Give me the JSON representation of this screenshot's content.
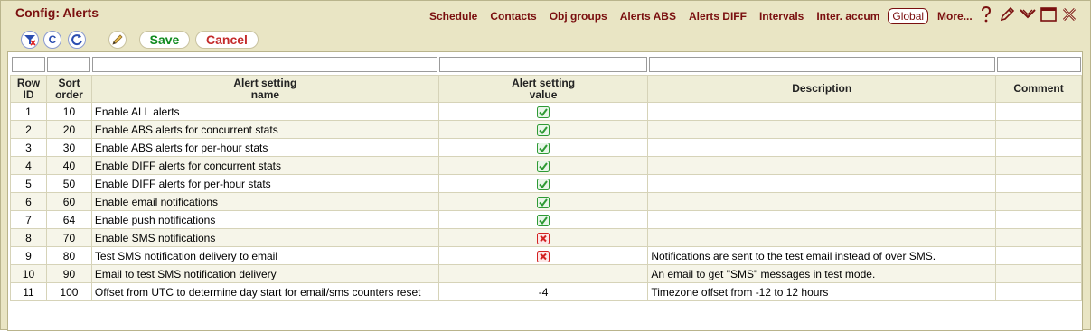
{
  "window": {
    "title": "Config: Alerts"
  },
  "nav": {
    "links": [
      {
        "label": "Schedule"
      },
      {
        "label": "Contacts"
      },
      {
        "label": "Obj groups"
      },
      {
        "label": "Alerts ABS"
      },
      {
        "label": "Alerts DIFF"
      },
      {
        "label": "Intervals"
      },
      {
        "label": "Inter. accum"
      },
      {
        "label": "Global"
      },
      {
        "label": "More..."
      }
    ],
    "icons": [
      "help-icon",
      "edit-pencil-icon",
      "collapse-chevron-icon",
      "maximize-icon",
      "close-icon"
    ]
  },
  "toolbar": {
    "save_label": "Save",
    "cancel_label": "Cancel",
    "icons": [
      "clear-filter-icon",
      "clear-icon",
      "refresh-icon",
      "edit-pencil-icon"
    ]
  },
  "colors": {
    "brand": "#7a0f0f",
    "save": "#0f8a1e",
    "cancel": "#c42b2b",
    "check_on": "#2e9a34",
    "check_off": "#d32222"
  },
  "table": {
    "headers": {
      "row_id": [
        "Row",
        "ID"
      ],
      "sort_order": [
        "Sort",
        "order"
      ],
      "name": [
        "Alert setting",
        "name"
      ],
      "value": [
        "Alert setting",
        "value"
      ],
      "description": "Description",
      "comment": "Comment"
    },
    "rows": [
      {
        "id": "1",
        "sort": "10",
        "name": "Enable ALL alerts",
        "value": "check-on",
        "description": "",
        "comment": ""
      },
      {
        "id": "2",
        "sort": "20",
        "name": "Enable ABS alerts for concurrent stats",
        "value": "check-on",
        "description": "",
        "comment": ""
      },
      {
        "id": "3",
        "sort": "30",
        "name": "Enable ABS alerts for per-hour stats",
        "value": "check-on",
        "description": "",
        "comment": ""
      },
      {
        "id": "4",
        "sort": "40",
        "name": "Enable DIFF alerts for concurrent stats",
        "value": "check-on",
        "description": "",
        "comment": ""
      },
      {
        "id": "5",
        "sort": "50",
        "name": "Enable DIFF alerts for per-hour stats",
        "value": "check-on",
        "description": "",
        "comment": ""
      },
      {
        "id": "6",
        "sort": "60",
        "name": "Enable email notifications",
        "value": "check-on",
        "description": "",
        "comment": ""
      },
      {
        "id": "7",
        "sort": "64",
        "name": "Enable push notifications",
        "value": "check-on",
        "description": "",
        "comment": ""
      },
      {
        "id": "8",
        "sort": "70",
        "name": "Enable SMS notifications",
        "value": "check-off",
        "description": "",
        "comment": ""
      },
      {
        "id": "9",
        "sort": "80",
        "name": "Test SMS notification delivery to email",
        "value": "check-off",
        "description": "Notifications are sent to the test email instead of over SMS.",
        "comment": ""
      },
      {
        "id": "10",
        "sort": "90",
        "name": "Email to test SMS notification delivery",
        "value": "",
        "description": "An email to get \"SMS\" messages in test mode.",
        "comment": ""
      },
      {
        "id": "11",
        "sort": "100",
        "name": "Offset from UTC to determine day start for email/sms counters reset",
        "value": "-4",
        "description": "Timezone offset from -12 to 12 hours",
        "comment": ""
      }
    ]
  }
}
